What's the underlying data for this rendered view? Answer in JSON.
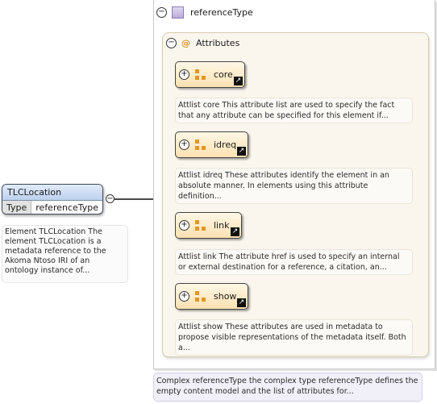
{
  "element": {
    "name": "TLCLocation",
    "type_label": "Type",
    "type_value": "referenceType",
    "documentation": "Element TLCLocation The element TLCLocation is a metadata reference to the Akoma Ntoso IRI of an ontology instance of..."
  },
  "complex_type": {
    "name": "referenceType",
    "documentation": "Complex referenceType the complex type referenceType defines the empty content model and the list of attributes for..."
  },
  "attributes": {
    "title": "Attributes",
    "at_symbol": "@",
    "groups": [
      {
        "name": "core",
        "documentation": "Attlist core This attribute list are used to specify the fact that any attribute can be specified for this element if..."
      },
      {
        "name": "idreq",
        "documentation": "Attlist idreq These attributes identify the element in an absolute manner. In elements using this attribute definition..."
      },
      {
        "name": "link",
        "documentation": "Attlist link The attribute href is used to specify an internal or external destination for a reference, a citation, an..."
      },
      {
        "name": "show",
        "documentation": "Attlist show These attributes are used in metadata to propose visible representations of the metadata itself. Both a..."
      }
    ]
  },
  "icons": {
    "collapse": "collapse-icon",
    "expand": "expand-icon",
    "type": "complex-type-icon",
    "attribute_group": "attribute-group-icon",
    "link": "link-arrow-icon"
  },
  "symbols": {
    "collapse": "−",
    "expand": "+",
    "link": "↗"
  },
  "colors": {
    "element_header": "#bcd0ee",
    "attribute_group": "#fbe1b1",
    "attribute_marker": "#e8951e",
    "type_icon": "#b9aadb"
  }
}
